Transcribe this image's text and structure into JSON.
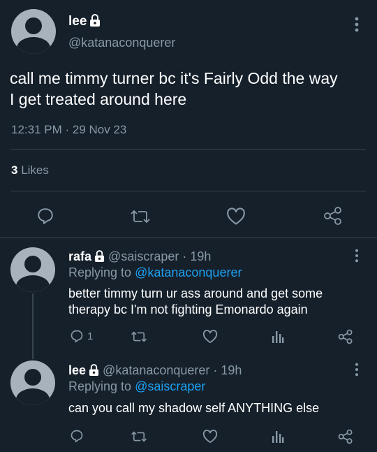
{
  "main_tweet": {
    "display_name": "lee",
    "handle": "@katanaconquerer",
    "text_line1": "call me timmy turner bc it's Fairly Odd the way",
    "text_line2": "I get treated around here",
    "timestamp": "12:31 PM · 29 Nov 23",
    "likes_count": "3",
    "likes_label": "Likes"
  },
  "replies": [
    {
      "display_name": "rafa",
      "handle_time": "@saiscraper · 19h",
      "replying_to_label": "Replying to",
      "replying_to_handle": "@katanaconquerer",
      "text_line1": "better timmy turn ur ass around and get some",
      "text_line2": "therapy bc I'm not fighting Emonardo again",
      "reply_count": "1"
    },
    {
      "display_name": "lee",
      "handle_time": "@katanaconquerer · 19h",
      "replying_to_label": "Replying to",
      "replying_to_handle": "@saiscraper",
      "text_line1": "can you call my shadow self ANYTHING else"
    }
  ],
  "colors": {
    "background": "#15202b",
    "text": "#ffffff",
    "muted": "#8899a6",
    "link": "#1da1f2",
    "divider": "#38444d"
  }
}
